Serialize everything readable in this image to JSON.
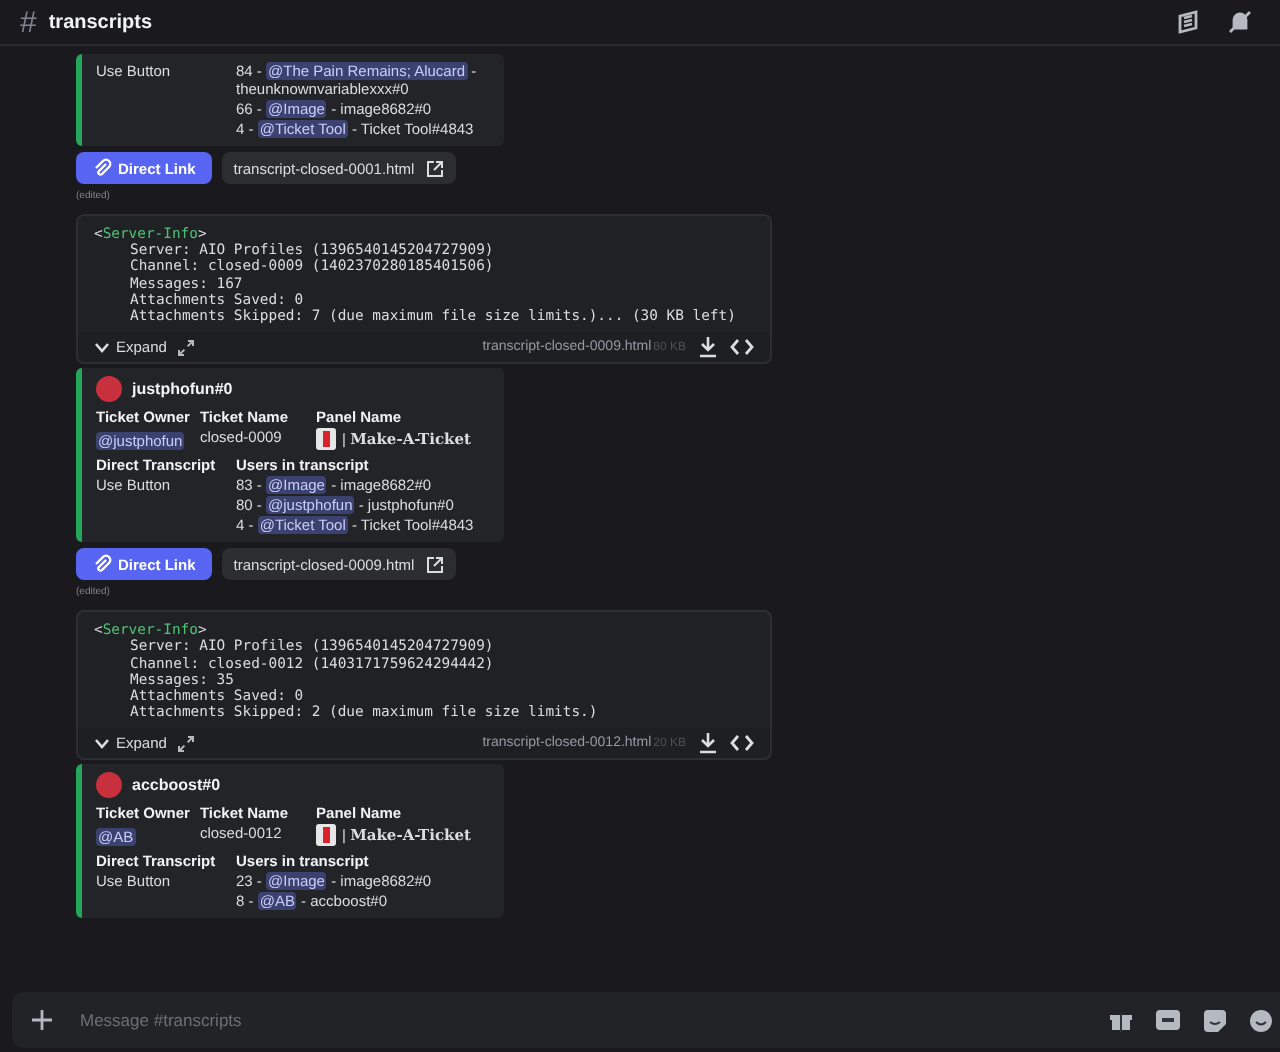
{
  "channel": {
    "hash": "#",
    "name": "transcripts"
  },
  "items": [
    {
      "kind": "embed",
      "direct_value": "Use Button",
      "users": [
        {
          "prefix": "84 -",
          "mention": "@The Pain Remains; Alucard",
          "suffix": "- theunknownvariablexxx#0"
        },
        {
          "prefix": "66 -",
          "mention": "@Image",
          "suffix": "- image8682#0"
        },
        {
          "prefix": "4 -",
          "mention": "@Ticket Tool",
          "suffix": "- Ticket Tool#4843"
        }
      ]
    },
    {
      "kind": "links",
      "button": "Direct Link",
      "file": "transcript-closed-0001.html"
    },
    {
      "kind": "edited",
      "text": "(edited)"
    },
    {
      "kind": "code",
      "open": "<",
      "tag": "Server-Info",
      "close": ">",
      "lines": [
        "Server: AIO Profiles (1396540145204727909)",
        "Channel: closed-0009 (1402370280185401506)",
        "Messages: 167",
        "Attachments Saved: 0",
        "Attachments Skipped: 7 (due maximum file size limits.)... (30 KB left)"
      ],
      "expand": "Expand",
      "file": "transcript-closed-0009.html",
      "size": "80 KB"
    },
    {
      "kind": "embed",
      "author": "justphofun#0",
      "h_owner": "Ticket Owner",
      "h_name": "Ticket Name",
      "h_panel": "Panel Name",
      "owner": "@justphofun",
      "ticket": "closed-0009",
      "panel": "| **Make-A-Ticket**",
      "h_direct": "Direct Transcript",
      "h_users": "Users in transcript",
      "direct_value": "Use Button",
      "users": [
        {
          "prefix": "83 -",
          "mention": "@Image",
          "suffix": "- image8682#0"
        },
        {
          "prefix": "80 -",
          "mention": "@justphofun",
          "suffix": "- justphofun#0"
        },
        {
          "prefix": "4 -",
          "mention": "@Ticket Tool",
          "suffix": "- Ticket Tool#4843"
        }
      ]
    },
    {
      "kind": "links",
      "button": "Direct Link",
      "file": "transcript-closed-0009.html"
    },
    {
      "kind": "edited",
      "text": "(edited)"
    },
    {
      "kind": "code",
      "open": "<",
      "tag": "Server-Info",
      "close": ">",
      "lines": [
        "Server: AIO Profiles (1396540145204727909)",
        "Channel: closed-0012 (1403171759624294442)",
        "Messages: 35",
        "Attachments Saved: 0",
        "Attachments Skipped: 2 (due maximum file size limits.)"
      ],
      "expand": "Expand",
      "file": "transcript-closed-0012.html",
      "size": "20 KB"
    },
    {
      "kind": "embed",
      "author": "accboost#0",
      "h_owner": "Ticket Owner",
      "h_name": "Ticket Name",
      "h_panel": "Panel Name",
      "owner": "@AB",
      "ticket": "closed-0012",
      "panel": "| **Make-A-Ticket**",
      "h_direct": "Direct Transcript",
      "h_users": "Users in transcript",
      "direct_value": "Use Button",
      "users": [
        {
          "prefix": "23 -",
          "mention": "@Image",
          "suffix": "- image8682#0"
        },
        {
          "prefix": "8 -",
          "mention": "@AB",
          "suffix": "- accboost#0"
        }
      ]
    }
  ],
  "composer": {
    "placeholder": "Message #transcripts"
  }
}
